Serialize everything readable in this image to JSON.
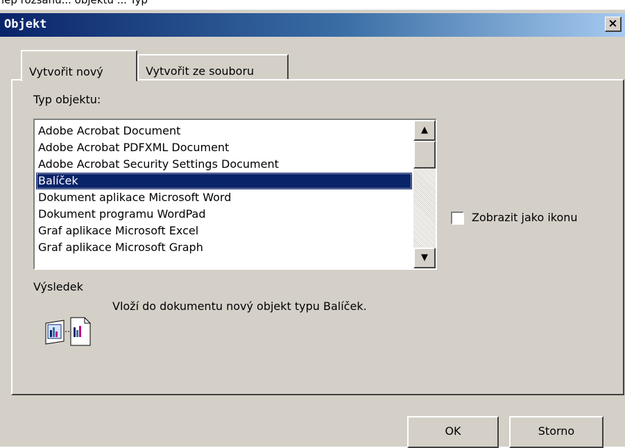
{
  "page_above": "lep rozsahu... objektu ... Typ",
  "dialog": {
    "title": "Objekt",
    "close_label": "×"
  },
  "tabs": {
    "create_new": "Vytvořit nový",
    "create_from_file": "Vytvořit ze souboru"
  },
  "object_type": {
    "label": "Typ objektu:",
    "items": [
      "Adobe Acrobat Document",
      "Adobe Acrobat PDFXML Document",
      "Adobe Acrobat Security Settings Document",
      "Balíček",
      "Dokument aplikace Microsoft Word",
      "Dokument programu WordPad",
      "Graf aplikace Microsoft Excel",
      "Graf aplikace Microsoft Graph"
    ],
    "selected": "Balíček"
  },
  "display_as_icon": {
    "label": "Zobrazit jako ikonu",
    "checked": false
  },
  "result": {
    "label": "Výsledek",
    "text": "Vloží do dokumentu nový objekt typu Balíček."
  },
  "buttons": {
    "ok": "OK",
    "cancel": "Storno"
  },
  "colors": {
    "dialog_bg": "#d4d0c8",
    "title_gradient_start": "#0a246a",
    "title_gradient_end": "#a6caf0",
    "selection_bg": "#0a246a"
  },
  "icons": {
    "scroll_up": "scroll-up-arrow-icon",
    "scroll_down": "scroll-down-arrow-icon",
    "result": "package-object-icon"
  }
}
